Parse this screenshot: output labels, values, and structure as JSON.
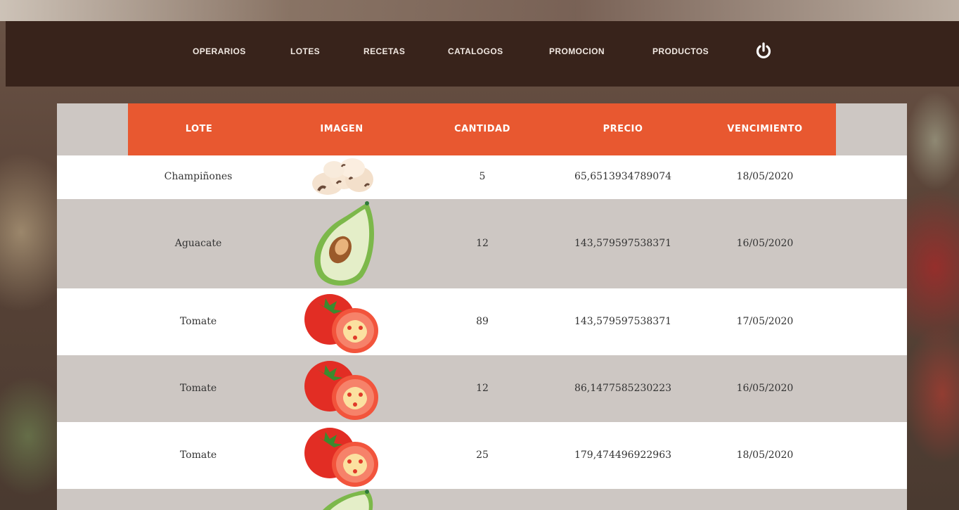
{
  "nav": {
    "items": [
      {
        "id": "operarios",
        "label": "OPERARIOS"
      },
      {
        "id": "lotes",
        "label": "LOTES"
      },
      {
        "id": "recetas",
        "label": "RECETAS"
      },
      {
        "id": "catalogos",
        "label": "CATALOGOS"
      },
      {
        "id": "promocion",
        "label": "PROMOCION"
      },
      {
        "id": "productos",
        "label": "PRODUCTOS"
      }
    ],
    "power_icon": "power-icon"
  },
  "table": {
    "headers": {
      "lote": "LOTE",
      "imagen": "IMAGEN",
      "cantidad": "CANTIDAD",
      "precio": "PRECIO",
      "vencimiento": "VENCIMIENTO"
    },
    "rows": [
      {
        "lote": "Champiñones",
        "image": "mushroom-image",
        "cantidad": "5",
        "precio": "65,6513934789074",
        "vencimiento": "18/05/2020"
      },
      {
        "lote": "Aguacate",
        "image": "avocado-image",
        "cantidad": "12",
        "precio": "143,579597538371",
        "vencimiento": "16/05/2020"
      },
      {
        "lote": "Tomate",
        "image": "tomato-image",
        "cantidad": "89",
        "precio": "143,579597538371",
        "vencimiento": "17/05/2020"
      },
      {
        "lote": "Tomate",
        "image": "tomato-image",
        "cantidad": "12",
        "precio": "86,1477585230223",
        "vencimiento": "16/05/2020"
      },
      {
        "lote": "Tomate",
        "image": "tomato-image",
        "cantidad": "25",
        "precio": "179,474496922963",
        "vencimiento": "18/05/2020"
      },
      {
        "lote": "",
        "image": "avocado-image",
        "cantidad": "",
        "precio": "",
        "vencimiento": ""
      }
    ]
  },
  "colors": {
    "header": "#e85830",
    "navbar": "#342018",
    "row_alt": "#cdc7c3",
    "row": "#ffffff"
  }
}
